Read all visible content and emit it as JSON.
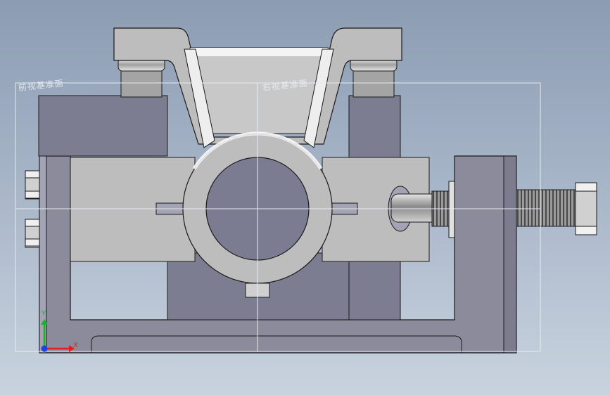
{
  "view": {
    "front_plane_label": "前视基准面",
    "right_plane_label": "右视基准面"
  },
  "triad": {
    "x_label": "X",
    "y_label": "Y",
    "x_color": "#e02020",
    "y_color": "#20b030",
    "z_color": "#2040e0"
  },
  "colors": {
    "background_top": "#8c9cb2",
    "background_bottom": "#c9d3df",
    "part_light": "#bcbcbc",
    "part_dark": "#8d8d9e",
    "plane_border": "#e6ebf1"
  }
}
